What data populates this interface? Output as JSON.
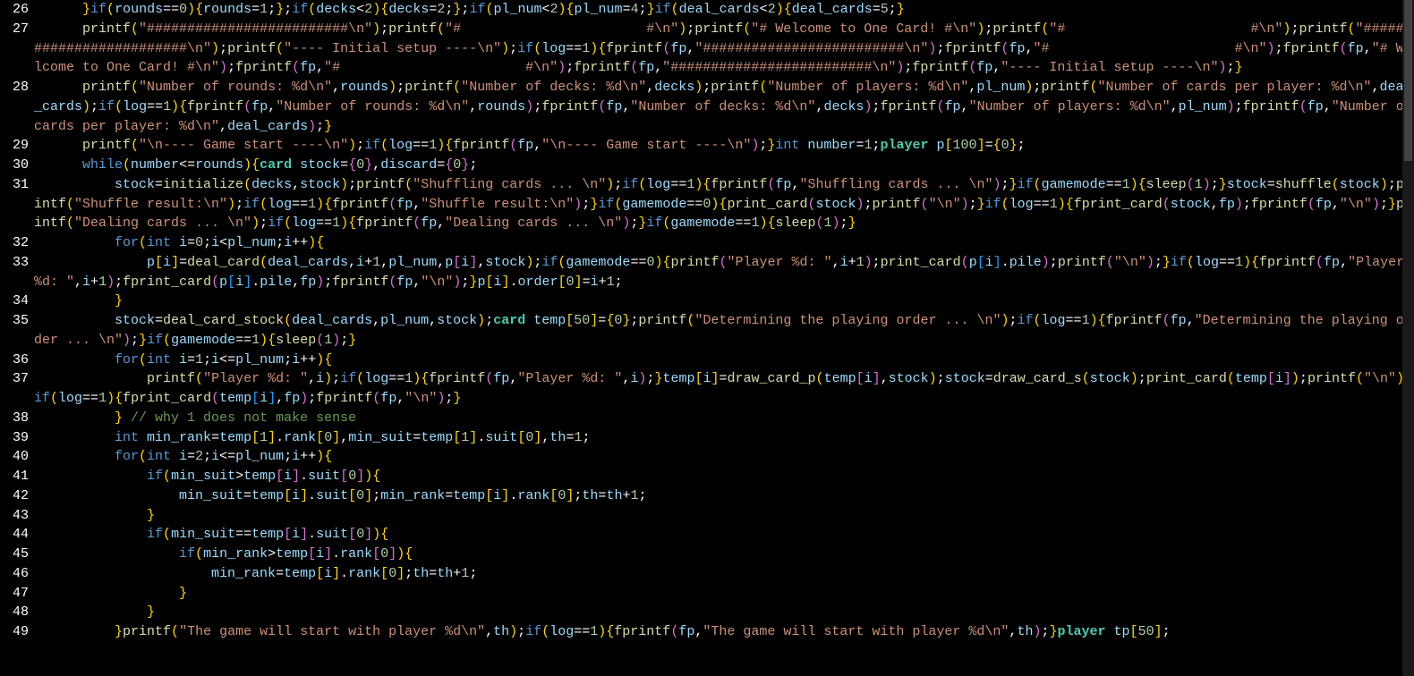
{
  "editor": {
    "language": "c",
    "font": "monospace",
    "theme": "dark-plus",
    "colors": {
      "background": "#000000",
      "keyword": "#569cd6",
      "function": "#dcdcaa",
      "type": "#4ec9b0",
      "string": "#ce9178",
      "number": "#b5cea8",
      "comment": "#6a9955",
      "variable": "#9cdcfe",
      "bracket1": "#ffd700",
      "bracket2": "#da70d6",
      "bracket3": "#179fff",
      "default": "#d4d4d4",
      "lineno": "#ffffff"
    },
    "first_line": 26,
    "last_line": 49,
    "lines": [
      {
        "n": 26,
        "indent": "      ",
        "text": "}if(rounds==0){rounds=1;};if(decks<2){decks=2;};if(pl_num<2){pl_num=4;}if(deal_cards<2){deal_cards=5;}"
      },
      {
        "n": 27,
        "indent": "      ",
        "text": "printf(\"#########################\\n\");printf(\"#                       #\\n\");printf(\"# Welcome to One Card! #\\n\");printf(\"#                       #\\n\");printf(\"#########################\\n\");printf(\"---- Initial setup ----\\n\");if(log==1){fprintf(fp,\"#########################\\n\");fprintf(fp,\"#                       #\\n\");fprintf(fp,\"# Welcome to One Card! #\\n\");fprintf(fp,\"#                       #\\n\");fprintf(fp,\"#########################\\n\");fprintf(fp,\"---- Initial setup ----\\n\");}"
      },
      {
        "n": 28,
        "indent": "      ",
        "text": "printf(\"Number of rounds: %d\\n\",rounds);printf(\"Number of decks: %d\\n\",decks);printf(\"Number of players: %d\\n\",pl_num);printf(\"Number of cards per player: %d\\n\",deal_cards);if(log==1){fprintf(fp,\"Number of rounds: %d\\n\",rounds);fprintf(fp,\"Number of decks: %d\\n\",decks);fprintf(fp,\"Number of players: %d\\n\",pl_num);fprintf(fp,\"Number of cards per player: %d\\n\",deal_cards);}"
      },
      {
        "n": 29,
        "indent": "      ",
        "text": "printf(\"\\n---- Game start ----\\n\");if(log==1){fprintf(fp,\"\\n---- Game start ----\\n\");}int number=1;player p[100]={0};"
      },
      {
        "n": 30,
        "indent": "      ",
        "text": "while(number<=rounds){card stock={0},discard={0};"
      },
      {
        "n": 31,
        "indent": "          ",
        "text": "stock=initialize(decks,stock);printf(\"Shuffling cards ... \\n\");if(log==1){fprintf(fp,\"Shuffling cards ... \\n\");}if(gamemode==1){sleep(1);}stock=shuffle(stock);printf(\"Shuffle result:\\n\");if(log==1){fprintf(fp,\"Shuffle result:\\n\");}if(gamemode==0){print_card(stock);printf(\"\\n\");}if(log==1){fprint_card(stock,fp);fprintf(fp,\"\\n\");}printf(\"Dealing cards ... \\n\");if(log==1){fprintf(fp,\"Dealing cards ... \\n\");}if(gamemode==1){sleep(1);}"
      },
      {
        "n": 32,
        "indent": "          ",
        "text": "for(int i=0;i<pl_num;i++){"
      },
      {
        "n": 33,
        "indent": "              ",
        "text": "p[i]=deal_card(deal_cards,i+1,pl_num,p[i],stock);if(gamemode==0){printf(\"Player %d: \",i+1);print_card(p[i].pile);printf(\"\\n\");}if(log==1){fprintf(fp,\"Player %d: \",i+1);fprint_card(p[i].pile,fp);fprintf(fp,\"\\n\");}p[i].order[0]=i+1;"
      },
      {
        "n": 34,
        "indent": "          ",
        "text": "}"
      },
      {
        "n": 35,
        "indent": "          ",
        "text": "stock=deal_card_stock(deal_cards,pl_num,stock);card temp[50]={0};printf(\"Determining the playing order ... \\n\");if(log==1){fprintf(fp,\"Determining the playing order ... \\n\");}if(gamemode==1){sleep(1);}"
      },
      {
        "n": 36,
        "indent": "          ",
        "text": "for(int i=1;i<=pl_num;i++){"
      },
      {
        "n": 37,
        "indent": "              ",
        "text": "printf(\"Player %d: \",i);if(log==1){fprintf(fp,\"Player %d: \",i);}temp[i]=draw_card_p(temp[i],stock);stock=draw_card_s(stock);print_card(temp[i]);printf(\"\\n\");if(log==1){fprint_card(temp[i],fp);fprintf(fp,\"\\n\");}"
      },
      {
        "n": 38,
        "indent": "          ",
        "text": "} // why 1 does not make sense"
      },
      {
        "n": 39,
        "indent": "          ",
        "text": "int min_rank=temp[1].rank[0],min_suit=temp[1].suit[0],th=1;"
      },
      {
        "n": 40,
        "indent": "          ",
        "text": "for(int i=2;i<=pl_num;i++){"
      },
      {
        "n": 41,
        "indent": "              ",
        "text": "if(min_suit>temp[i].suit[0]){"
      },
      {
        "n": 42,
        "indent": "                  ",
        "text": "min_suit=temp[i].suit[0];min_rank=temp[i].rank[0];th=th+1;"
      },
      {
        "n": 43,
        "indent": "              ",
        "text": "}"
      },
      {
        "n": 44,
        "indent": "              ",
        "text": "if(min_suit==temp[i].suit[0]){"
      },
      {
        "n": 45,
        "indent": "                  ",
        "text": "if(min_rank>temp[i].rank[0]){"
      },
      {
        "n": 46,
        "indent": "                      ",
        "text": "min_rank=temp[i].rank[0];th=th+1;"
      },
      {
        "n": 47,
        "indent": "                  ",
        "text": "}"
      },
      {
        "n": 48,
        "indent": "              ",
        "text": "}"
      },
      {
        "n": 49,
        "indent": "          ",
        "text": "}printf(\"The game will start with player %d\\n\",th);if(log==1){fprintf(fp,\"The game will start with player %d\\n\",th);}player tp[50];"
      }
    ]
  }
}
